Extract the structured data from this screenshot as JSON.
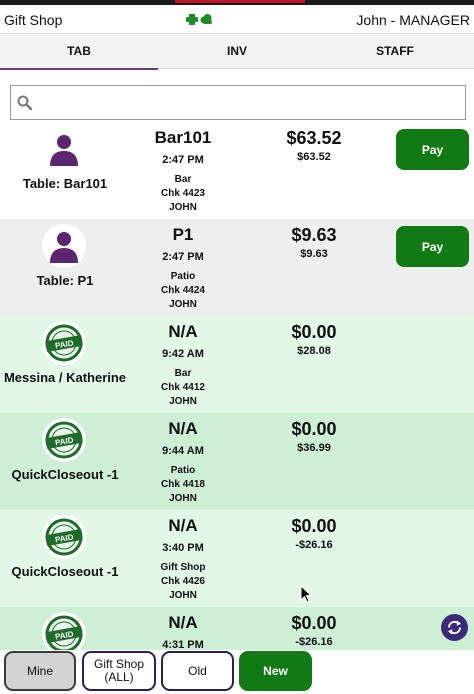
{
  "header": {
    "app_title": "Gift Shop",
    "user": "John - MANAGER",
    "status_icons": [
      "printer-icon",
      "cloud-icon"
    ]
  },
  "tabs": [
    {
      "label": "TAB",
      "active": true
    },
    {
      "label": "INV",
      "active": false
    },
    {
      "label": "STAFF",
      "active": false
    }
  ],
  "search": {
    "placeholder": "",
    "value": ""
  },
  "rows": [
    {
      "name": "Table: Bar101",
      "tab": "Bar101",
      "time": "2:47 PM",
      "area": "Bar",
      "check": "Chk 4423",
      "user": "JOHN",
      "due": "$63.52",
      "total": "$63.52",
      "action": "Pay",
      "icon": "person-icon",
      "status": "open"
    },
    {
      "name": "Table: P1",
      "tab": "P1",
      "time": "2:47 PM",
      "area": "Patio",
      "check": "Chk 4424",
      "user": "JOHN",
      "due": "$9.63",
      "total": "$9.63",
      "action": "Pay",
      "icon": "person-icon",
      "status": "open"
    },
    {
      "name": "Messina / Katherine",
      "tab": "N/A",
      "time": "9:42 AM",
      "area": "Bar",
      "check": "Chk 4412",
      "user": "JOHN",
      "due": "$0.00",
      "total": "$28.08",
      "icon": "paid-stamp-icon",
      "status": "paid"
    },
    {
      "name": "QuickCloseout -1",
      "tab": "N/A",
      "time": "9:44 AM",
      "area": "Patio",
      "check": "Chk 4418",
      "user": "JOHN",
      "due": "$0.00",
      "total": "$36.99",
      "icon": "paid-stamp-icon",
      "status": "paid"
    },
    {
      "name": "QuickCloseout -1",
      "tab": "N/A",
      "time": "3:40 PM",
      "area": "Gift Shop",
      "check": "Chk 4426",
      "user": "JOHN",
      "due": "$0.00",
      "total": "-$26.16",
      "icon": "paid-stamp-icon",
      "status": "paid"
    },
    {
      "name": "",
      "tab": "N/A",
      "time": "4:31 PM",
      "area": "",
      "check": "",
      "user": "",
      "due": "$0.00",
      "total": "-$26.16",
      "icon": "paid-stamp-icon",
      "status": "paid"
    }
  ],
  "paid_stamp_text": "PAID",
  "footer": {
    "mine": "Mine",
    "gift_shop": "Gift Shop\n(ALL)",
    "old": "Old",
    "new": "New"
  },
  "colors": {
    "accent_purple": "#6a3a7a",
    "pay_green": "#117a14",
    "paid_row_light": "#e3f7e6",
    "paid_row_dark": "#cfeed6",
    "refresh_button": "#3b2a7a"
  }
}
